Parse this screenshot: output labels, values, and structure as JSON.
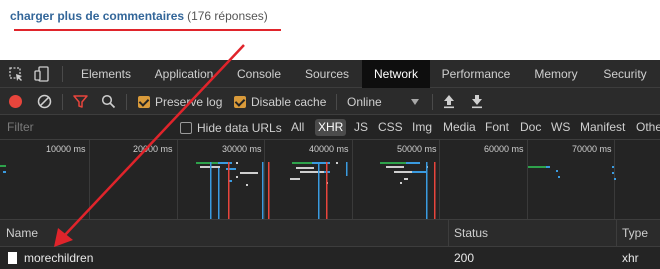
{
  "page": {
    "load_more_link": "charger plus de commentaires",
    "load_more_count": "(176 réponses)"
  },
  "devtools": {
    "tabs": [
      {
        "label": "Elements"
      },
      {
        "label": "Application"
      },
      {
        "label": "Console"
      },
      {
        "label": "Sources"
      },
      {
        "label": "Network"
      },
      {
        "label": "Performance"
      },
      {
        "label": "Memory"
      },
      {
        "label": "Security"
      }
    ],
    "active_tab": "Network",
    "toolbar": {
      "preserve_log_label": "Preserve log",
      "preserve_log_checked": true,
      "disable_cache_label": "Disable cache",
      "disable_cache_checked": true,
      "throttling_value": "Online"
    },
    "filter": {
      "placeholder": "Filter",
      "hide_data_urls_label": "Hide data URLs",
      "types": [
        "All",
        "XHR",
        "JS",
        "CSS",
        "Img",
        "Media",
        "Font",
        "Doc",
        "WS",
        "Manifest",
        "Other"
      ],
      "active_type": "XHR"
    },
    "overview": {
      "ticks": [
        "10000 ms",
        "20000 ms",
        "30000 ms",
        "40000 ms",
        "50000 ms",
        "60000 ms",
        "70000 ms"
      ]
    },
    "table": {
      "columns": [
        "Name",
        "Status",
        "Type"
      ],
      "rows": [
        {
          "name": "morechildren",
          "status": "200",
          "type": "xhr"
        }
      ]
    }
  },
  "colors": {
    "accent_red": "#e0242b",
    "link_blue": "#336699",
    "record_red": "#e8453c",
    "checkbox_orange": "#d99a3a",
    "devtools_bg": "#242424"
  }
}
